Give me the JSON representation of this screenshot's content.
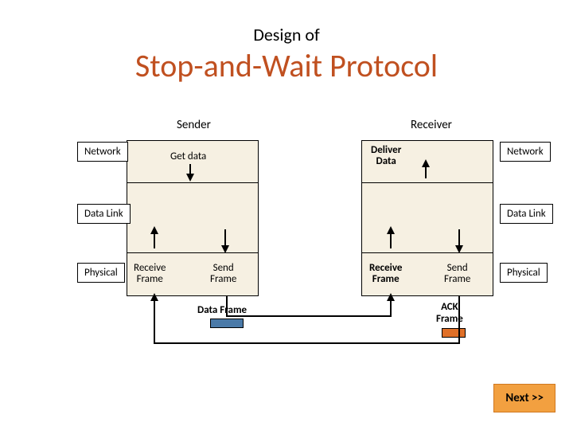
{
  "title_small": "Design of",
  "title_big": "Stop-and-Wait Protocol",
  "columns": {
    "sender": "Sender",
    "receiver": "Receiver"
  },
  "layers": {
    "network": "Network",
    "datalink": "Data Link",
    "physical": "Physical"
  },
  "sender_box": {
    "get_data": "Get data",
    "receive_frame": "Receive\nFrame",
    "send_frame": "Send\nFrame"
  },
  "receiver_box": {
    "deliver_data": "Deliver\nData",
    "receive_frame": "Receive\nFrame",
    "send_frame": "Send\nFrame"
  },
  "frames": {
    "data_frame": "Data Frame",
    "ack_frame": "ACK\nFrame"
  },
  "next_button": "Next >>"
}
